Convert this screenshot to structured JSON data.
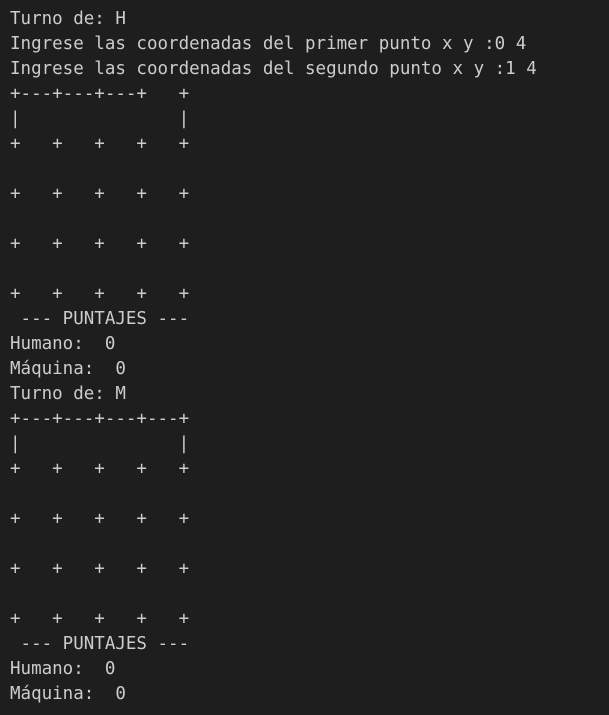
{
  "terminal": {
    "lines": [
      "Turno de: H",
      "Ingrese las coordenadas del primer punto x y :0 4",
      "Ingrese las coordenadas del segundo punto x y :1 4",
      "+---+---+---+   +",
      "|               |",
      "+   +   +   +   +",
      "",
      "+   +   +   +   +",
      "",
      "+   +   +   +   +",
      "",
      "+   +   +   +   +",
      " --- PUNTAJES ---",
      "Humano:  0",
      "Máquina:  0",
      "Turno de: M",
      "+---+---+---+---+",
      "|               |",
      "+   +   +   +   +",
      "",
      "+   +   +   +   +",
      "",
      "+   +   +   +   +",
      "",
      "+   +   +   +   +",
      " --- PUNTAJES ---",
      "Humano:  0",
      "Máquina:  0"
    ]
  },
  "colors": {
    "background": "#1e1e1e",
    "text": "#cccccc"
  }
}
